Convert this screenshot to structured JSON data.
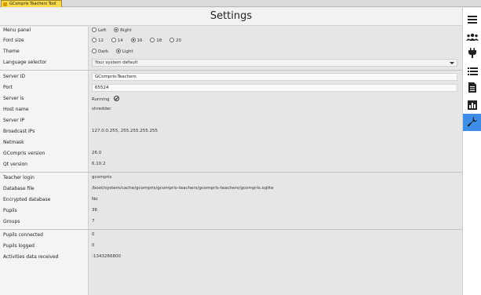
{
  "window": {
    "tab_title": "GCompris Teachers Tool"
  },
  "header": {
    "title": "Settings"
  },
  "sidebar": {
    "icons": [
      {
        "name": "menu-icon"
      },
      {
        "name": "users-icon"
      },
      {
        "name": "plugin-icon"
      },
      {
        "name": "list-icon"
      },
      {
        "name": "document-icon"
      },
      {
        "name": "chart-icon"
      },
      {
        "name": "wrench-icon",
        "active": true
      }
    ],
    "accent_color": "#3e8ee8"
  },
  "settings": {
    "menu_panel": {
      "label": "Menu panel",
      "options": [
        "Left",
        "Right"
      ],
      "selected": "Right"
    },
    "font_size": {
      "label": "Font size",
      "options": [
        "12",
        "14",
        "16",
        "18",
        "20"
      ],
      "selected": "16"
    },
    "theme": {
      "label": "Theme",
      "options": [
        "Dark",
        "Light"
      ],
      "selected": "Light"
    },
    "language": {
      "label": "Language selector",
      "value": "Your system default"
    },
    "server_id": {
      "label": "Server ID",
      "value": "GCompris-Teachers"
    },
    "port": {
      "label": "Port",
      "value": "65524"
    },
    "server_is": {
      "label": "Server is",
      "value": "Running"
    },
    "host_name": {
      "label": "Host name",
      "value": "shredder"
    },
    "server_ip": {
      "label": "Server IP",
      "value": ""
    },
    "broadcast_ips": {
      "label": "Broadcast IPs",
      "value": "127.0.0.255, 255.255.255.255"
    },
    "netmask": {
      "label": "Netmask",
      "value": ""
    },
    "gcompris_version": {
      "label": "GCompris version",
      "value": "26.0"
    },
    "qt_version": {
      "label": "Qt version",
      "value": "6.10.2"
    },
    "teacher_login": {
      "label": "Teacher login",
      "value": "gcompris"
    },
    "database_file": {
      "label": "Database file",
      "value": "/boot/system/cache/gcompris/gcompris-teachers/gcompris-teachers/gcompris.sqlite"
    },
    "encrypted_db": {
      "label": "Encrypted database",
      "value": "No"
    },
    "pupils": {
      "label": "Pupils",
      "value": "36"
    },
    "groups": {
      "label": "Groups",
      "value": "7"
    },
    "pupils_connected": {
      "label": "Pupils connected",
      "value": "0"
    },
    "pupils_logged": {
      "label": "Pupils logged",
      "value": "0"
    },
    "activities_received": {
      "label": "Activities data received",
      "value": "-1343266800"
    }
  }
}
